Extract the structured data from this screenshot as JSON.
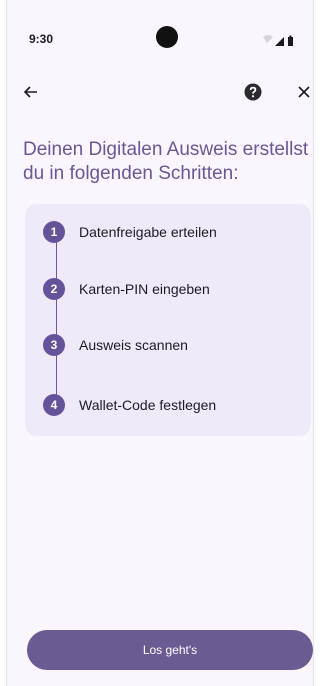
{
  "status_bar": {
    "time": "9:30",
    "icons": [
      "wifi-icon",
      "signal-icon",
      "battery-icon"
    ]
  },
  "app_bar": {
    "icons": [
      "back-arrow-icon",
      "help-icon",
      "close-icon"
    ]
  },
  "title": "Deinen Digitalen Ausweis erstellst du in folgenden Schritten:",
  "steps": [
    {
      "number": "1",
      "label": "Datenfreigabe erteilen"
    },
    {
      "number": "2",
      "label": "Karten-PIN eingeben"
    },
    {
      "number": "3",
      "label": "Ausweis scannen"
    },
    {
      "number": "4",
      "label": "Wallet-Code festlegen"
    }
  ],
  "cta": {
    "label": "Los geht's"
  },
  "colors": {
    "accent": "#65539a",
    "title": "#6a5896",
    "card": "#efe9fa",
    "background": "#fbf5fd"
  }
}
